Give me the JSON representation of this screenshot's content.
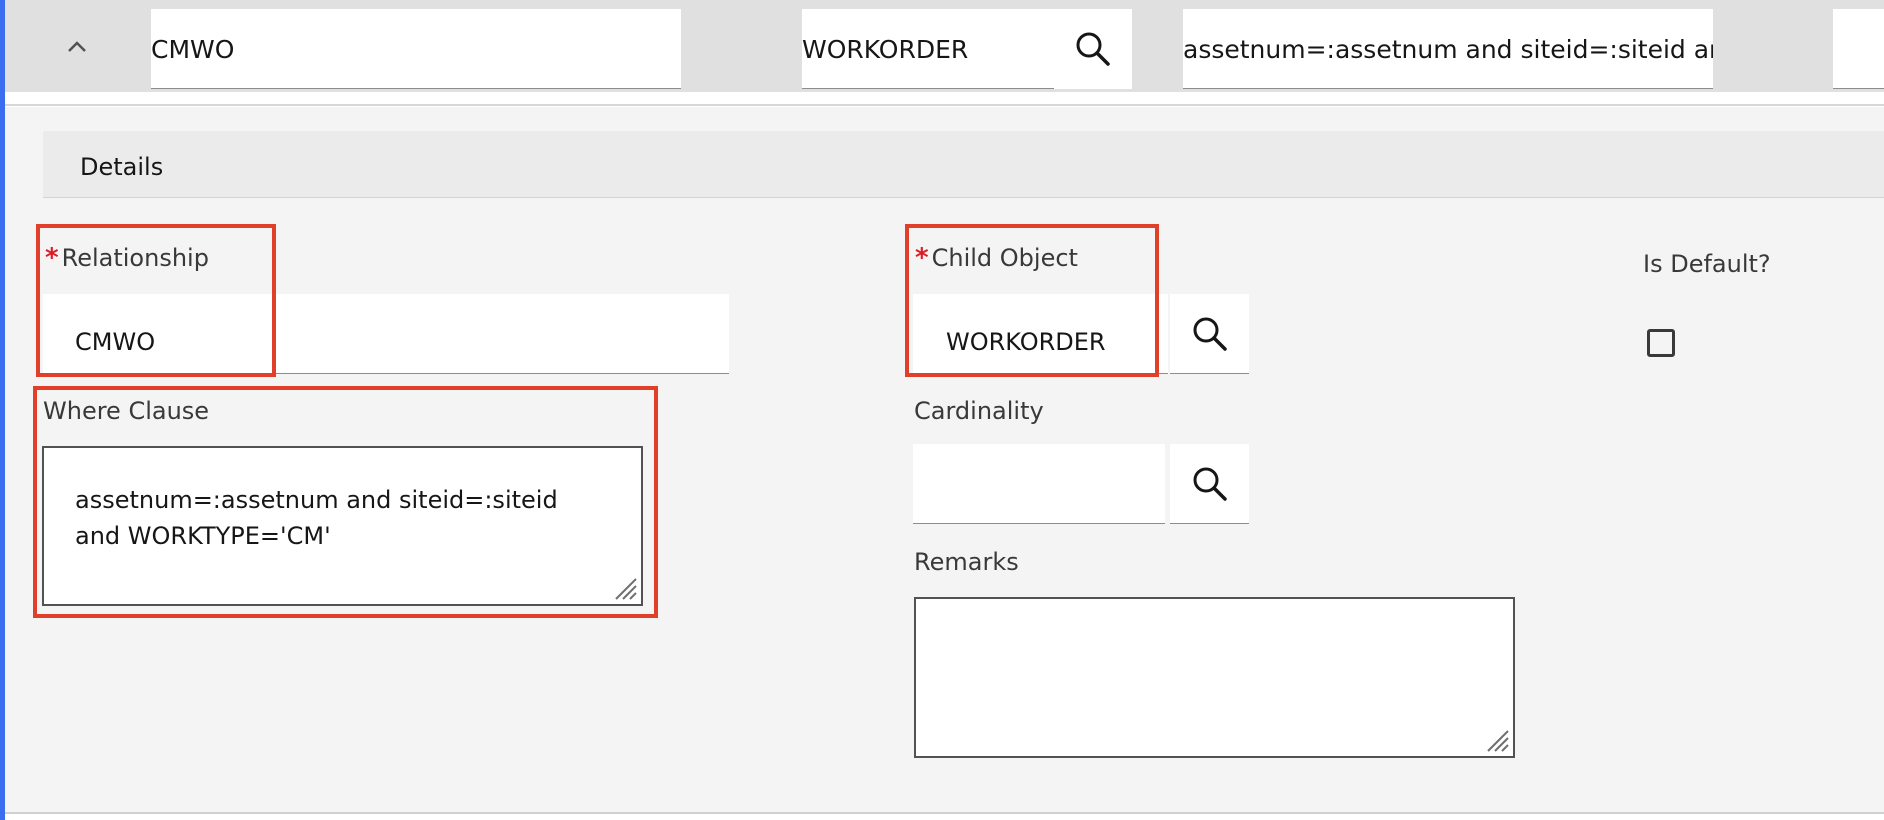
{
  "top_row": {
    "relationship_value": "CMWO",
    "child_object_value": "WORKORDER",
    "where_clause_value": "assetnum=:assetnum and siteid=:siteid and WORKTYPE='CM'"
  },
  "details": {
    "section_title": "Details"
  },
  "form": {
    "relationship": {
      "required_mark": "*",
      "label": "Relationship",
      "value": "CMWO"
    },
    "where_clause": {
      "label": "Where Clause",
      "value": "assetnum=:assetnum and siteid=:siteid and WORKTYPE='CM'"
    },
    "child_object": {
      "required_mark": "*",
      "label": "Child Object",
      "value": "WORKORDER"
    },
    "cardinality": {
      "label": "Cardinality",
      "value": ""
    },
    "remarks": {
      "label": "Remarks",
      "value": ""
    },
    "is_default": {
      "label": "Is Default?",
      "checked": false
    }
  },
  "icons": {
    "collapse": "chevron-up-icon",
    "lookup": "search-icon",
    "resize": "resize-grip-icon"
  },
  "colors": {
    "highlight": "#e0402a",
    "required": "#da1e28",
    "accent": "#3a6df0"
  }
}
